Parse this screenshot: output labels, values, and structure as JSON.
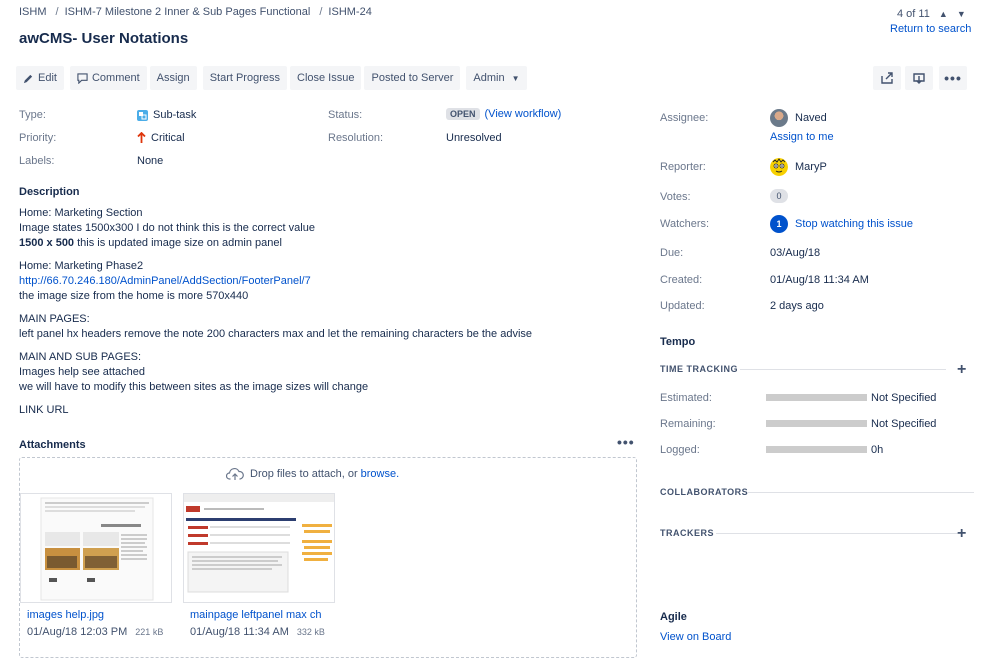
{
  "breadcrumb": [
    "ISHM",
    "ISHM-7 Milestone 2 Inner & Sub Pages Functional",
    "ISHM-24"
  ],
  "title": "awCMS- User Notations",
  "pager": {
    "text": "4 of 11",
    "return": "Return to search"
  },
  "toolbar": {
    "edit": "Edit",
    "comment": "Comment",
    "assign": "Assign",
    "start_progress": "Start Progress",
    "close_issue": "Close Issue",
    "posted_to_server": "Posted to Server",
    "admin": "Admin"
  },
  "details": {
    "type_label": "Type:",
    "type_value": "Sub-task",
    "priority_label": "Priority:",
    "priority_value": "Critical",
    "labels_label": "Labels:",
    "labels_value": "None",
    "status_label": "Status:",
    "status_value": "OPEN",
    "view_workflow": "(View workflow)",
    "resolution_label": "Resolution:",
    "resolution_value": "Unresolved"
  },
  "description": {
    "heading": "Description",
    "p1_l1": "Home: Marketing Section",
    "p1_l2": "Image states 1500x300 I do not think this is the correct value",
    "p1_l3_bold": "1500 x 500",
    "p1_l3_rest": " this is updated image size on admin panel",
    "p2_l1": "Home: Marketing Phase2",
    "p2_link": "http://66.70.246.180/AdminPanel/AddSection/FooterPanel/7",
    "p2_l3": "the image size from the home is more 570x440",
    "p3_l1": "MAIN PAGES:",
    "p3_l2": "left panel hx headers remove the note 200 characters max and let the remaining characters be the advise",
    "p4_l1": "MAIN AND SUB PAGES:",
    "p4_l2": "Images help see attached",
    "p4_l3": "we will have to modify this between sites as the image sizes will change",
    "p5": "LINK URL"
  },
  "attachments": {
    "heading": "Attachments",
    "drop_text": "Drop files to attach, or ",
    "browse": "browse.",
    "files": [
      {
        "name": "images help.jpg",
        "date": "01/Aug/18 12:03 PM",
        "size": "221 kB"
      },
      {
        "name": "mainpage leftpanel max cha",
        "date": "01/Aug/18 11:34 AM",
        "size": "332 kB"
      }
    ]
  },
  "people": {
    "assignee_label": "Assignee:",
    "assignee": "Naved",
    "assign_to_me": "Assign to me",
    "reporter_label": "Reporter:",
    "reporter": "MaryP",
    "votes_label": "Votes:",
    "votes": "0",
    "watchers_label": "Watchers:",
    "watchers": "1",
    "stop_watching": "Stop watching this issue"
  },
  "dates": {
    "due_label": "Due:",
    "due": "03/Aug/18",
    "created_label": "Created:",
    "created": "01/Aug/18 11:34 AM",
    "updated_label": "Updated:",
    "updated": "2 days ago"
  },
  "tempo": {
    "heading": "Tempo",
    "time_tracking": "TIME TRACKING",
    "estimated_label": "Estimated:",
    "estimated": "Not Specified",
    "remaining_label": "Remaining:",
    "remaining": "Not Specified",
    "logged_label": "Logged:",
    "logged": "0h",
    "collaborators": "COLLABORATORS",
    "trackers": "TRACKERS"
  },
  "agile": {
    "heading": "Agile",
    "view_on_board": "View on Board"
  },
  "colors": {
    "link": "#0052cc",
    "critical": "#de350b",
    "subtask": "#4bade8",
    "bar": "#cccccc"
  }
}
